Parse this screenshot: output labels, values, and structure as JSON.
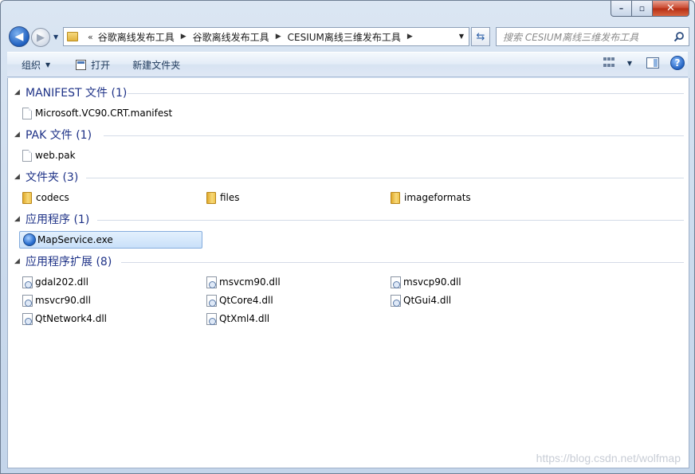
{
  "window": {
    "controls": {
      "minimize": "–",
      "maximize": "▫",
      "close": "✕"
    }
  },
  "nav": {
    "back_icon": "arrow-left-icon",
    "forward_icon": "arrow-right-icon",
    "breadcrumb_overflow": "«",
    "breadcrumbs": [
      "谷歌离线发布工具",
      "谷歌离线发布工具",
      "CESIUM离线三维发布工具"
    ],
    "search_placeholder": "搜索 CESIUM离线三维发布工具"
  },
  "toolbar": {
    "organize_label": "组织",
    "open_label": "打开",
    "new_folder_label": "新建文件夹",
    "help_label": "?"
  },
  "groups": [
    {
      "label": "MANIFEST 文件 (1)",
      "items": [
        "Microsoft.VC90.CRT.manifest"
      ]
    },
    {
      "label": "PAK 文件 (1)",
      "items": [
        "web.pak"
      ]
    },
    {
      "label": "文件夹 (3)",
      "items": [
        "codecs",
        "files",
        "imageformats"
      ]
    },
    {
      "label": "应用程序 (1)",
      "items": [
        "MapService.exe"
      ]
    },
    {
      "label": "应用程序扩展 (8)",
      "items": [
        "gdal202.dll",
        "msvcm90.dll",
        "msvcp90.dll",
        "msvcr90.dll",
        "QtCore4.dll",
        "QtGui4.dll",
        "QtNetwork4.dll",
        "QtXml4.dll"
      ]
    }
  ],
  "selected_item": "MapService.exe",
  "watermark": "https://blog.csdn.net/wolfmap",
  "colors": {
    "group_header": "#1e3287",
    "selection": "#c9e0f9",
    "close_button": "#c8452b"
  }
}
